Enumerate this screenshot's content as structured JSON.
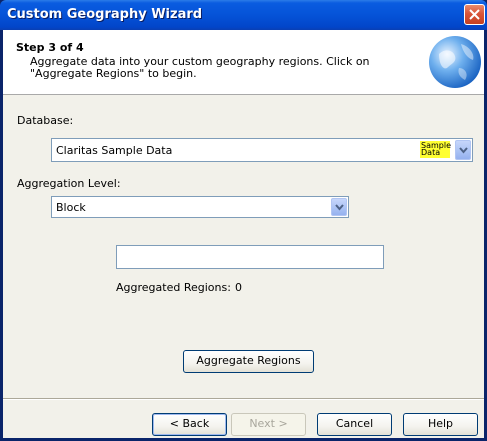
{
  "window": {
    "title": "Custom Geography Wizard"
  },
  "header": {
    "step": "Step 3 of 4",
    "description": "Aggregate data into your custom geography regions.  Click on \"Aggregate Regions\" to begin."
  },
  "database": {
    "label": "Database:",
    "value": "Claritas Sample Data",
    "badge_line1": "Sample",
    "badge_line2": "Data"
  },
  "aggregation": {
    "label": "Aggregation Level:",
    "value": "Block"
  },
  "progress": {
    "value": ""
  },
  "status": {
    "label": "Aggregated Regions:",
    "count": "0"
  },
  "actions": {
    "aggregate_label": "Aggregate Regions"
  },
  "footer": {
    "back_label": "< Back",
    "next_label": "Next >",
    "cancel_label": "Cancel",
    "help_label": "Help"
  },
  "colors": {
    "titlebar": "#0553d8",
    "badge": "#ffff33",
    "dialog_bg": "#f2f1ea"
  }
}
